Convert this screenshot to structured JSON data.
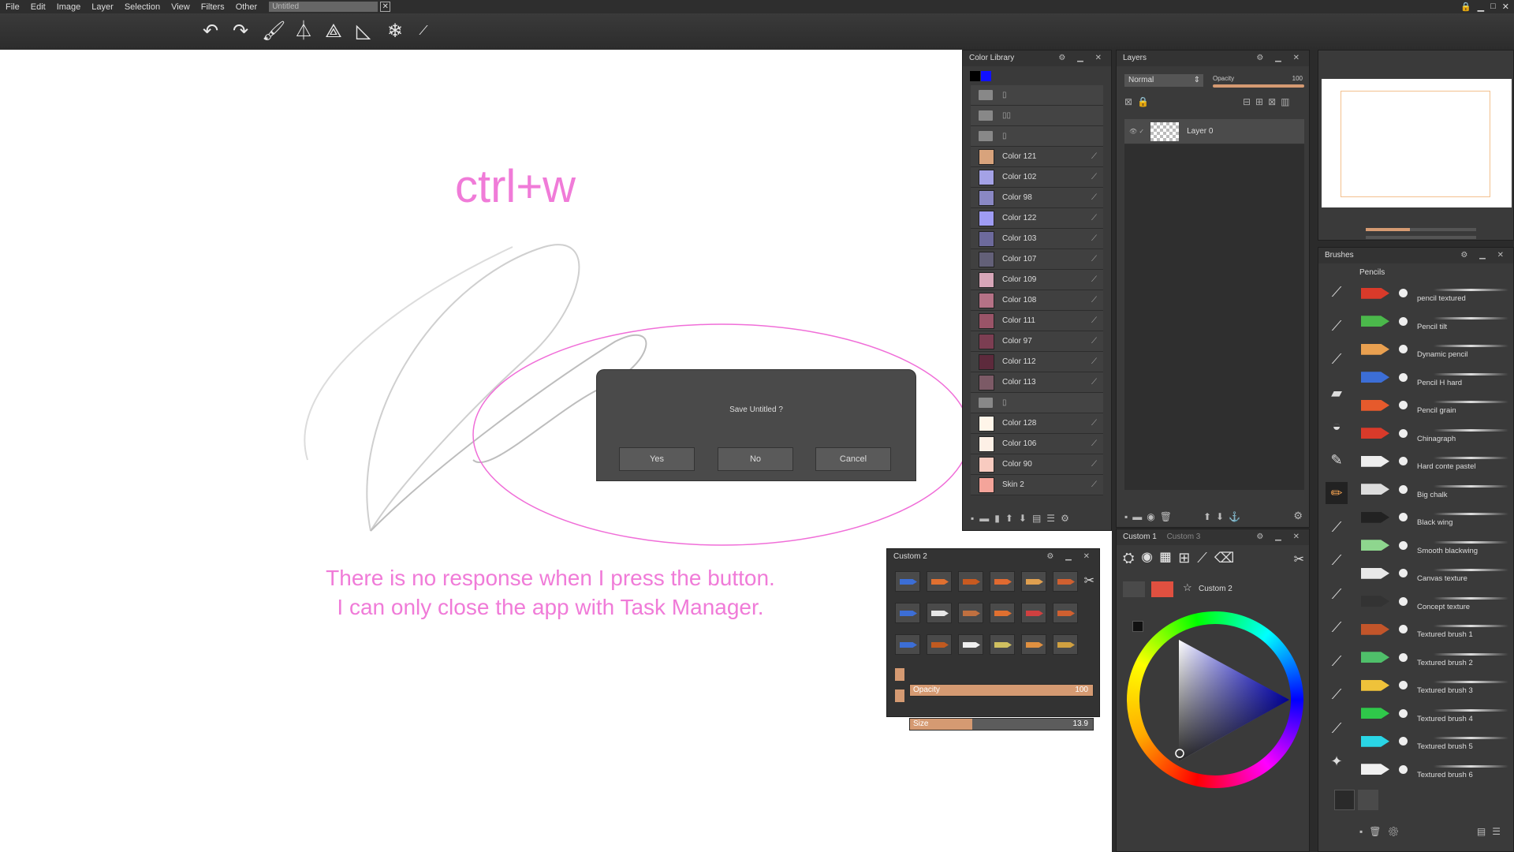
{
  "menu": [
    "File",
    "Edit",
    "Image",
    "Layer",
    "Selection",
    "View",
    "Filters",
    "Other"
  ],
  "document_tab": "Untitled",
  "annotation": {
    "shortcut": "ctrl+w",
    "line1": "There is no response when I press the button.",
    "line2": "I can only close the app with Task Manager."
  },
  "dialog": {
    "message": "Save Untitled ?",
    "yes": "Yes",
    "no": "No",
    "cancel": "Cancel"
  },
  "color_library": {
    "title": "Color Library",
    "colors_group1": [
      {
        "name": "Color 121",
        "hex": "#d8a37c"
      },
      {
        "name": "Color 102",
        "hex": "#a4a2e6"
      },
      {
        "name": "Color 98",
        "hex": "#8a88c4"
      },
      {
        "name": "Color 122",
        "hex": "#9f9cf4"
      },
      {
        "name": "Color 103",
        "hex": "#6d6a9c"
      },
      {
        "name": "Color 107",
        "hex": "#636078"
      },
      {
        "name": "Color 109",
        "hex": "#d7a6b8"
      },
      {
        "name": "Color 108",
        "hex": "#b57286"
      },
      {
        "name": "Color 111",
        "hex": "#9a5468"
      },
      {
        "name": "Color 97",
        "hex": "#7c3e52"
      },
      {
        "name": "Color 112",
        "hex": "#5d2a3c"
      },
      {
        "name": "Color 113",
        "hex": "#7c5a66"
      }
    ],
    "colors_group2": [
      {
        "name": "Color 128",
        "hex": "#fff5e9"
      },
      {
        "name": "Color 106",
        "hex": "#fdf0e6"
      },
      {
        "name": "Color 90",
        "hex": "#f8cbc0"
      },
      {
        "name": "Skin 2",
        "hex": "#f4a49a"
      }
    ]
  },
  "layers": {
    "title": "Layers",
    "blend_mode": "Normal",
    "opacity_label": "Opacity",
    "opacity_value": "100",
    "items": [
      {
        "name": "Layer 0"
      }
    ]
  },
  "brushes": {
    "title": "Brushes",
    "category": "Pencils",
    "items": [
      {
        "name": "pencil textured",
        "color": "#d93a2a"
      },
      {
        "name": "Pencil tilt",
        "color": "#4bb84b"
      },
      {
        "name": "Dynamic pencil",
        "color": "#e9a050"
      },
      {
        "name": "Pencil H hard",
        "color": "#3c6ed6"
      },
      {
        "name": "Pencil grain",
        "color": "#e65a2c"
      },
      {
        "name": "Chinagraph",
        "color": "#d93a2a"
      },
      {
        "name": "Hard conte pastel",
        "color": "#eeeeee"
      },
      {
        "name": "Big chalk",
        "color": "#dddddd"
      },
      {
        "name": "Black wing",
        "color": "#222222"
      },
      {
        "name": "Smooth blackwing",
        "color": "#8ed68e"
      },
      {
        "name": "Canvas texture",
        "color": "#e8e8e8"
      },
      {
        "name": "Concept texture",
        "color": "#333333"
      },
      {
        "name": "Textured brush 1",
        "color": "#c2552a"
      },
      {
        "name": "Textured brush 2",
        "color": "#4fbf6a"
      },
      {
        "name": "Textured brush 3",
        "color": "#efc23a"
      },
      {
        "name": "Textured brush 4",
        "color": "#2fc84a"
      },
      {
        "name": "Textured brush 5",
        "color": "#2ad6e6"
      },
      {
        "name": "Textured brush 6",
        "color": "#f0f0f0"
      }
    ]
  },
  "custom2": {
    "title": "Custom 2",
    "opacity_label": "Opacity",
    "opacity_value": "100",
    "opacity_fraction": 1.0,
    "size_label": "Size",
    "size_value": "13.9",
    "size_fraction": 0.34
  },
  "color_panel": {
    "tabs": [
      "Custom 1",
      "Custom 3"
    ],
    "preset_label": "Custom 2"
  }
}
